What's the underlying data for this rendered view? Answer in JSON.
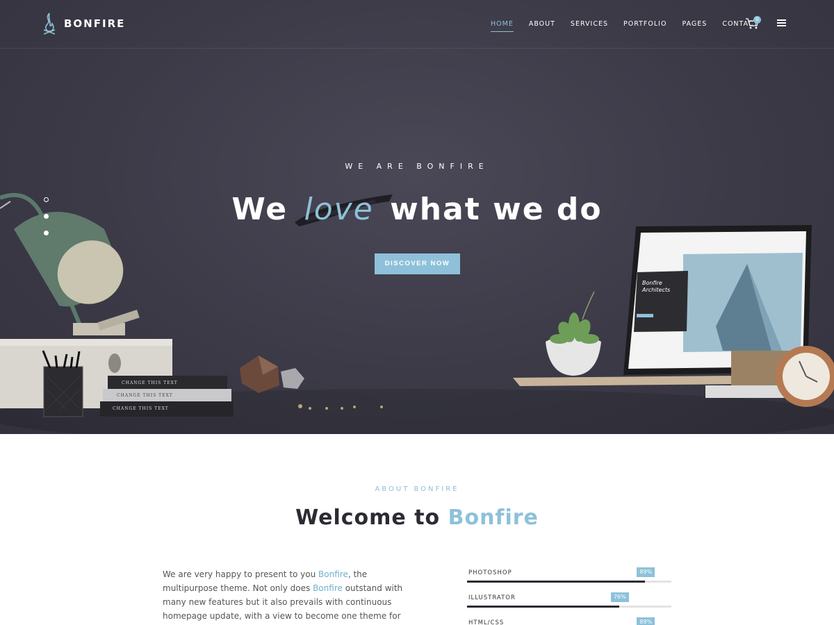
{
  "header": {
    "logo_text": "BONFIRE",
    "nav": [
      {
        "label": "HOME",
        "active": true
      },
      {
        "label": "ABOUT",
        "active": false
      },
      {
        "label": "SERVICES",
        "active": false
      },
      {
        "label": "PORTFOLIO",
        "active": false
      },
      {
        "label": "PAGES",
        "active": false
      },
      {
        "label": "CONTACT",
        "active": false
      }
    ],
    "cart_icon": "cart-icon",
    "cart_count": "0",
    "menu_icon": "hamburger-menu-icon"
  },
  "hero": {
    "kicker": "WE ARE BONFIRE",
    "headline_pre": "We",
    "headline_accent": "love",
    "headline_post": "what we do",
    "cta_label": "DISCOVER NOW",
    "slides": 3,
    "active_slide": 1,
    "mock": {
      "book_labels": [
        "CHANGE THIS TEXT",
        "CHANGE THIS TEXT",
        "CHANGE THIS TEXT"
      ],
      "laptop_title": "Bonfire Architects"
    }
  },
  "about": {
    "kicker": "ABOUT BONFIRE",
    "title_pre": "Welcome to",
    "title_accent": "Bonfire",
    "text_1": "We are very happy to present to you ",
    "text_hl1": "Bonfire",
    "text_2": ", the multipurpose theme. Not only does ",
    "text_hl2": "Bonfire",
    "text_3": " outstand with many new features but it also prevails with continuous homepage update, with a view to become one theme for all business.",
    "skills": [
      {
        "label": "PHOTOSHOP",
        "value": 89,
        "display": "89%"
      },
      {
        "label": "ILLUSTRATOR",
        "value": 76,
        "display": "76%"
      },
      {
        "label": "HTML/CSS",
        "value": 89,
        "display": "89%"
      }
    ]
  },
  "colors": {
    "accent": "#8ec1d9",
    "hero_bg": "#3c3a47",
    "dark_text": "#2b2b33"
  }
}
